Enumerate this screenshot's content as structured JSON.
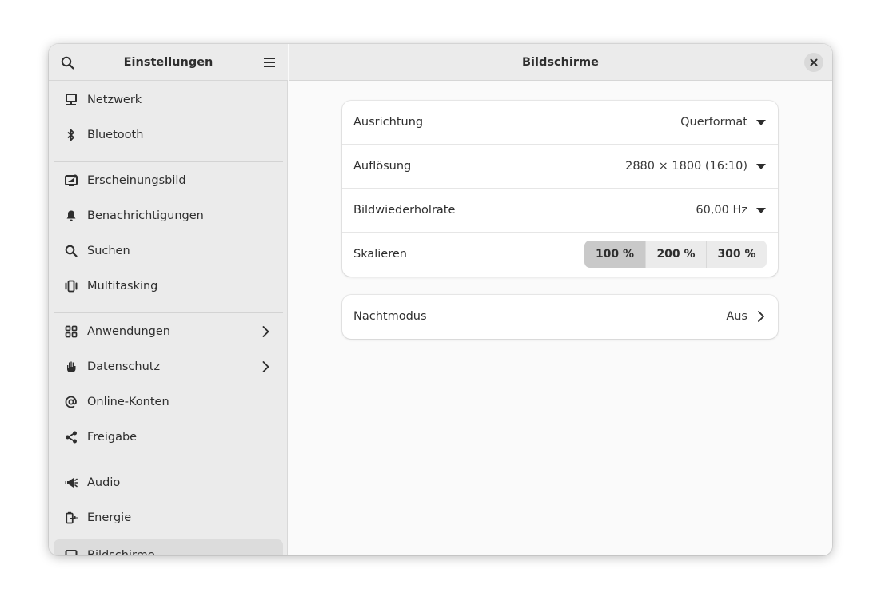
{
  "sidebar": {
    "title": "Einstellungen",
    "items": [
      {
        "label": "Netzwerk",
        "icon": "network-icon"
      },
      {
        "label": "Bluetooth",
        "icon": "bluetooth-icon"
      },
      {
        "label": "Erscheinungsbild",
        "icon": "appearance-icon"
      },
      {
        "label": "Benachrichtigungen",
        "icon": "bell-icon"
      },
      {
        "label": "Suchen",
        "icon": "search-icon"
      },
      {
        "label": "Multitasking",
        "icon": "multitasking-icon"
      },
      {
        "label": "Anwendungen",
        "icon": "apps-grid-icon"
      },
      {
        "label": "Datenschutz",
        "icon": "hand-icon"
      },
      {
        "label": "Online-Konten",
        "icon": "at-icon"
      },
      {
        "label": "Freigabe",
        "icon": "share-icon"
      },
      {
        "label": "Audio",
        "icon": "speaker-icon"
      },
      {
        "label": "Energie",
        "icon": "battery-plug-icon"
      },
      {
        "label": "Bildschirme",
        "icon": "display-icon",
        "active": true
      }
    ]
  },
  "main": {
    "title": "Bildschirme",
    "display_card": {
      "orientation": {
        "label": "Ausrichtung",
        "value": "Querformat"
      },
      "resolution": {
        "label": "Auflösung",
        "value": "2880 × 1800 (16:10)"
      },
      "refresh_rate": {
        "label": "Bildwiederholrate",
        "value": "60,00 Hz"
      },
      "scale": {
        "label": "Skalieren",
        "options": [
          "100 %",
          "200 %",
          "300 %"
        ],
        "selected": "100 %"
      }
    },
    "night_card": {
      "night_mode": {
        "label": "Nachtmodus",
        "value": "Aus"
      }
    }
  }
}
